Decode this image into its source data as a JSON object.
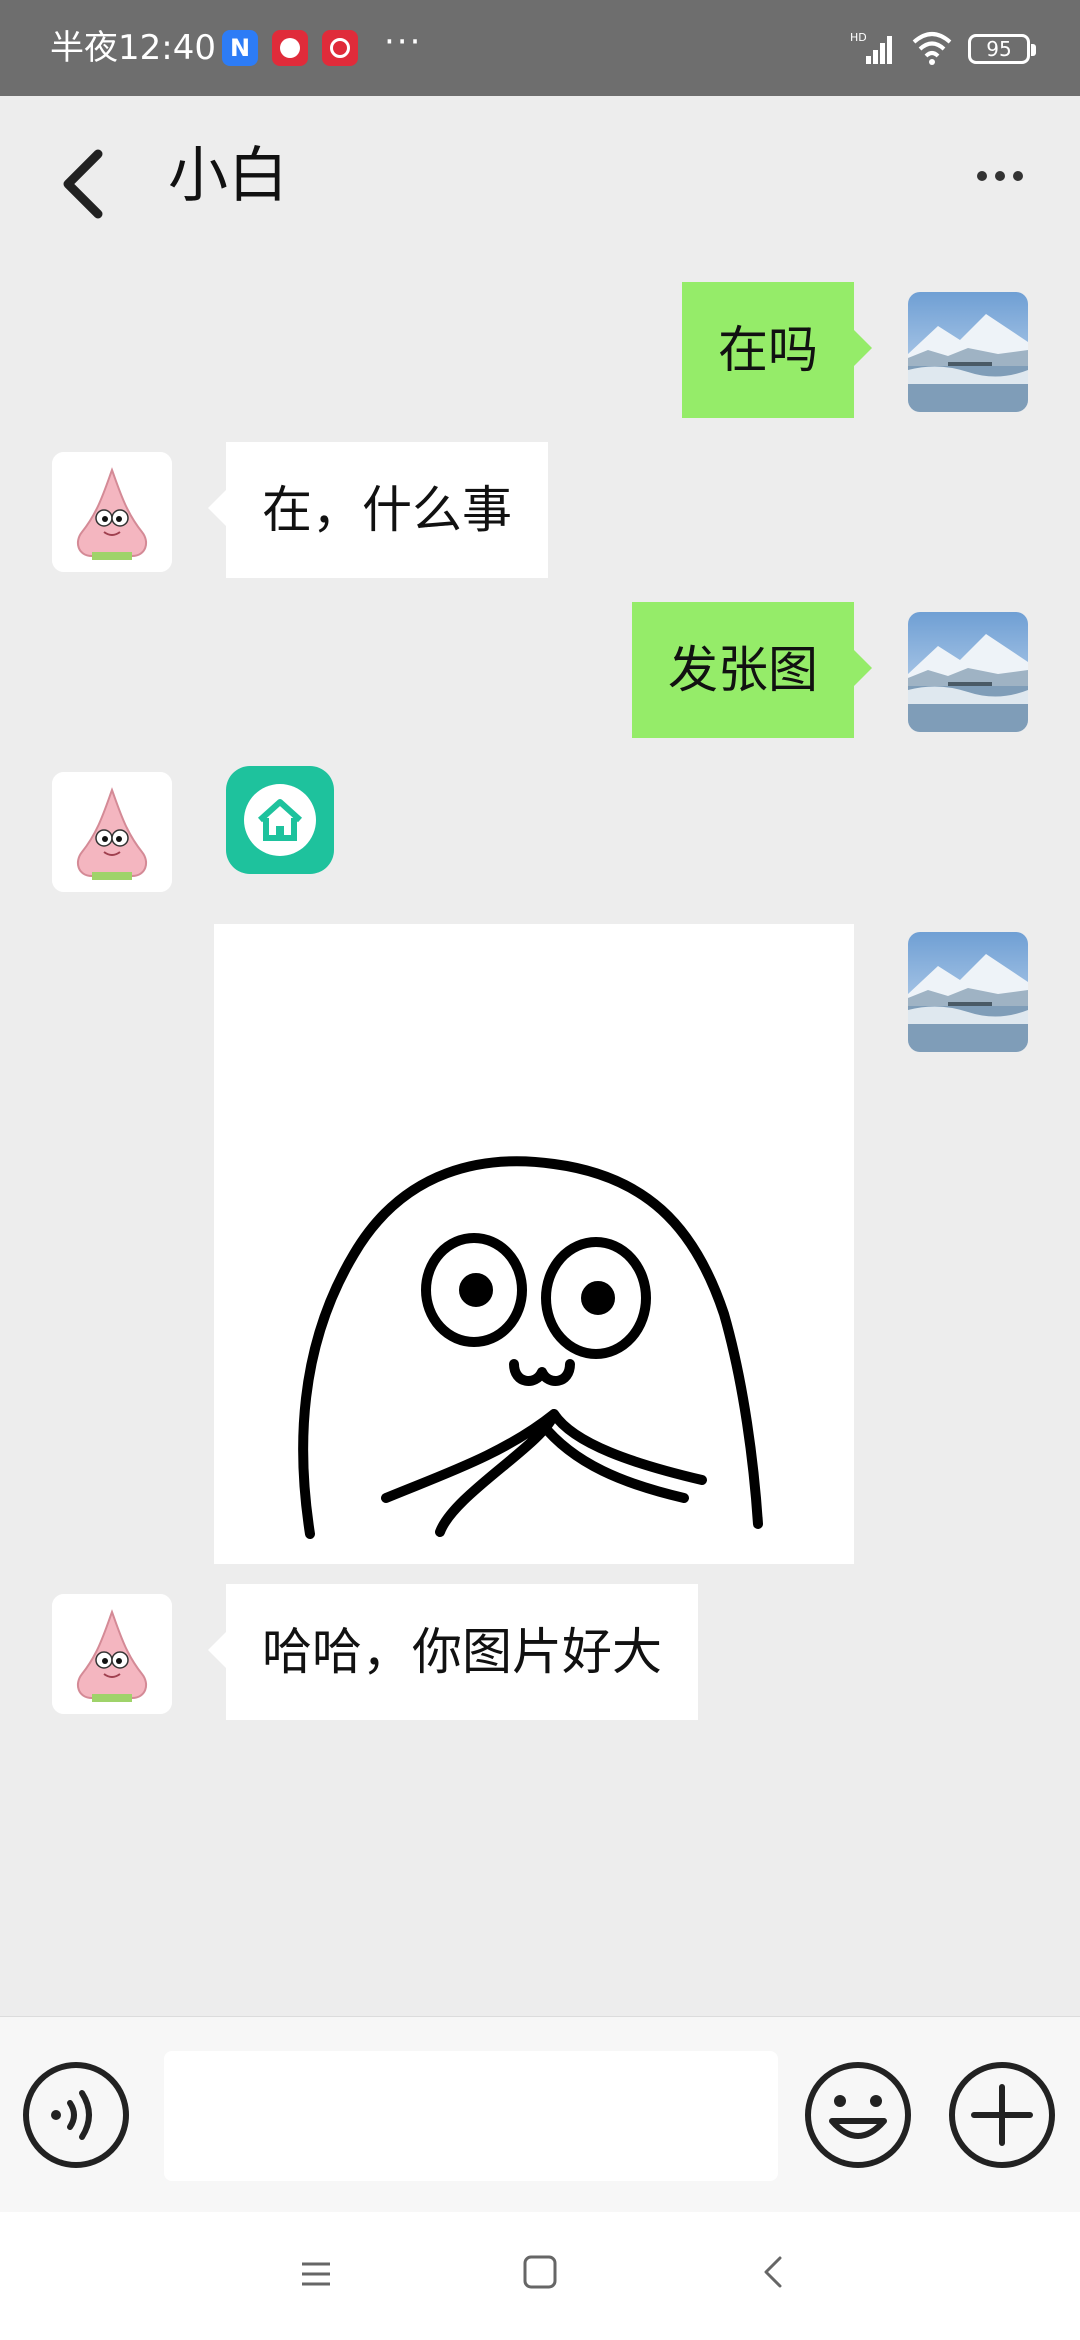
{
  "status_bar": {
    "time": "半夜12:40",
    "more": "···",
    "network": "HD",
    "battery": "95",
    "notification_icons": [
      "n-app-icon",
      "weibo-icon",
      "netease-music-icon"
    ]
  },
  "header": {
    "title": "小白",
    "back_icon": "chevron-left-icon",
    "more_icon": "more-dots-icon"
  },
  "messages": [
    {
      "from": "self",
      "type": "text",
      "text": "在吗"
    },
    {
      "from": "friend",
      "type": "text",
      "text": "在，什么事"
    },
    {
      "from": "self",
      "type": "text",
      "text": "发张图"
    },
    {
      "from": "friend",
      "type": "sticker",
      "icon": "home-icon"
    },
    {
      "from": "self",
      "type": "image",
      "icon": "doodle-praying-sticker"
    },
    {
      "from": "friend",
      "type": "text",
      "text": "哈哈，你图片好大"
    }
  ],
  "input_bar": {
    "value": "",
    "placeholder": "",
    "voice_icon": "voice-icon",
    "emoji_icon": "emoji-icon",
    "plus_icon": "plus-icon"
  },
  "system_nav": [
    "menu-icon",
    "home-square-icon",
    "back-icon"
  ],
  "colors": {
    "self_bubble": "#95ec69",
    "friend_bubble": "#ffffff",
    "chat_background": "#ededed",
    "status_bar": "#6e6e6e",
    "home_sticker": "#1ec29d"
  }
}
